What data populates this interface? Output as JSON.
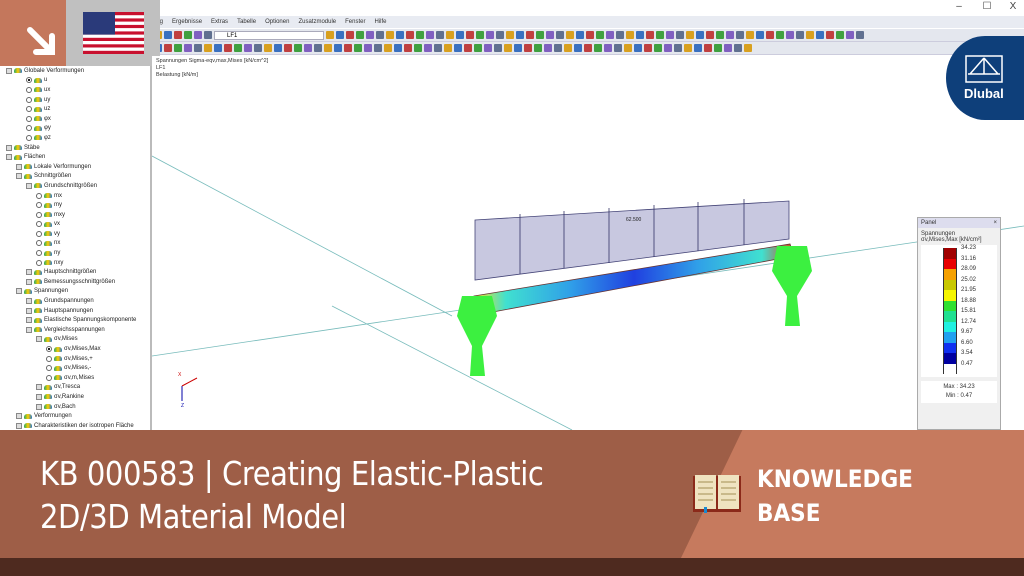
{
  "window": {
    "minimize": "–",
    "maximize": "☐",
    "close": "X"
  },
  "menu": [
    "ung",
    "Ergebnisse",
    "Extras",
    "Tabelle",
    "Optionen",
    "Zusatzmodule",
    "Fenster",
    "Hilfe"
  ],
  "toolbar": {
    "load_case": "LF1"
  },
  "viewport": {
    "info": [
      "Spannungen Sigma-eqv,max,Mises [kN/cm^2]",
      "LF1",
      "Belastung [kN/m]"
    ],
    "load_value": "62.500",
    "axis_x": "X",
    "axis_z": "Z"
  },
  "tree": [
    {
      "l": 0,
      "t": "box",
      "label": "Globale Verformungen"
    },
    {
      "l": 2,
      "t": "radon",
      "label": "u"
    },
    {
      "l": 2,
      "t": "rad",
      "label": "ux"
    },
    {
      "l": 2,
      "t": "rad",
      "label": "uy"
    },
    {
      "l": 2,
      "t": "rad",
      "label": "uz"
    },
    {
      "l": 2,
      "t": "rad",
      "label": "φx"
    },
    {
      "l": 2,
      "t": "rad",
      "label": "φy"
    },
    {
      "l": 2,
      "t": "rad",
      "label": "φz"
    },
    {
      "l": 0,
      "t": "box",
      "label": "Stäbe"
    },
    {
      "l": 0,
      "t": "box",
      "label": "Flächen"
    },
    {
      "l": 1,
      "t": "box",
      "label": "Lokale Verformungen"
    },
    {
      "l": 1,
      "t": "box",
      "label": "Schnittgrößen"
    },
    {
      "l": 2,
      "t": "box",
      "label": "Grundschnittgrößen"
    },
    {
      "l": 3,
      "t": "rad",
      "label": "mx"
    },
    {
      "l": 3,
      "t": "rad",
      "label": "my"
    },
    {
      "l": 3,
      "t": "rad",
      "label": "mxy"
    },
    {
      "l": 3,
      "t": "rad",
      "label": "vx"
    },
    {
      "l": 3,
      "t": "rad",
      "label": "vy"
    },
    {
      "l": 3,
      "t": "rad",
      "label": "nx"
    },
    {
      "l": 3,
      "t": "rad",
      "label": "ny"
    },
    {
      "l": 3,
      "t": "rad",
      "label": "nxy"
    },
    {
      "l": 2,
      "t": "box",
      "label": "Hauptschnittgrößen"
    },
    {
      "l": 2,
      "t": "box",
      "label": "Bemessungsschnittgrößen"
    },
    {
      "l": 1,
      "t": "box",
      "label": "Spannungen"
    },
    {
      "l": 2,
      "t": "box",
      "label": "Grundspannungen"
    },
    {
      "l": 2,
      "t": "box",
      "label": "Hauptspannungen"
    },
    {
      "l": 2,
      "t": "box",
      "label": "Elastische Spannungskomponente"
    },
    {
      "l": 2,
      "t": "box",
      "label": "Vergleichsspannungen"
    },
    {
      "l": 3,
      "t": "box",
      "label": "σv,Mises"
    },
    {
      "l": 4,
      "t": "radon",
      "label": "σv,Mises,Max"
    },
    {
      "l": 4,
      "t": "rad",
      "label": "σv,Mises,+"
    },
    {
      "l": 4,
      "t": "rad",
      "label": "σv,Mises,-"
    },
    {
      "l": 4,
      "t": "rad",
      "label": "σv,m,Mises"
    },
    {
      "l": 3,
      "t": "box",
      "label": "σv,Tresca"
    },
    {
      "l": 3,
      "t": "box",
      "label": "σv,Rankine"
    },
    {
      "l": 3,
      "t": "box",
      "label": "σv,Bach"
    },
    {
      "l": 1,
      "t": "box",
      "label": "Verformungen"
    },
    {
      "l": 1,
      "t": "box",
      "label": "Charakteristiken der isotropen Fläche"
    }
  ],
  "panel": {
    "title": "Panel",
    "close": "×",
    "heading": "Spannungen",
    "quantity": "σv,Mises,Max [kN/cm²]",
    "legend": [
      {
        "v": "34.23",
        "c": "#a00000"
      },
      {
        "v": "31.16",
        "c": "#e80000"
      },
      {
        "v": "28.09",
        "c": "#f5a000"
      },
      {
        "v": "25.02",
        "c": "#c8c800"
      },
      {
        "v": "21.95",
        "c": "#f5f500"
      },
      {
        "v": "18.88",
        "c": "#30e030"
      },
      {
        "v": "15.81",
        "c": "#20e090"
      },
      {
        "v": "12.74",
        "c": "#20f0e0"
      },
      {
        "v": "9.67",
        "c": "#20a0f0"
      },
      {
        "v": "6.60",
        "c": "#1030f0"
      },
      {
        "v": "3.54",
        "c": "#0000a0"
      },
      {
        "v": "0.47",
        "c": ""
      }
    ],
    "max_label": "Max",
    "max": "34.23",
    "min_label": "Min",
    "min": "0.47"
  },
  "logo": {
    "text": "Dlubal"
  },
  "banner": {
    "title_line1": "KB 000583 | Creating Elastic-Plastic",
    "title_line2": "2D/3D Material Model",
    "category_line1": "KNOWLEDGE",
    "category_line2": "BASE"
  },
  "colors": {
    "banner_dark": "#9e5e47",
    "banner_light": "#c67a5e",
    "strip": "#4e2a1f",
    "accent": "#c4775c"
  }
}
